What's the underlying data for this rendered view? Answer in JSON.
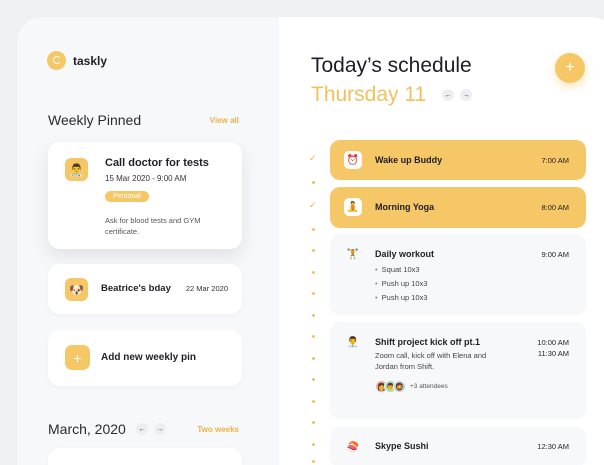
{
  "brand": {
    "name": "taskly"
  },
  "pinned": {
    "heading": "Weekly Pinned",
    "view_all": "View all",
    "cards": [
      {
        "title": "Call doctor for tests",
        "datetime": "15 Mar 2020 - 9:00 AM",
        "tag": "Personal",
        "description": "Ask for blood tests and GYM certificate.",
        "avatar": "doctor"
      },
      {
        "title": "Beatrice's bday",
        "date": "22 Mar 2020",
        "avatar": "dog"
      }
    ],
    "add_label": "Add new weekly pin"
  },
  "calendar": {
    "month": "March, 2020",
    "range": "Two weeks"
  },
  "schedule": {
    "title": "Today’s schedule",
    "day": "Thursday 11",
    "events": [
      {
        "title": "Wake up Buddy",
        "time": "7:00 AM",
        "icon": "alarm-clock-icon",
        "highlighted": true,
        "done": true
      },
      {
        "title": "Morning Yoga",
        "time": "8:00 AM",
        "icon": "yoga-icon",
        "highlighted": true,
        "done": true
      },
      {
        "title": "Daily workout",
        "time": "9:00 AM",
        "icon": "workout-icon",
        "items": [
          "Squat 10x3",
          "Push up 10x3",
          "Push up 10x3"
        ]
      },
      {
        "title": "Shift project kick off pt.1",
        "time_start": "10:00 AM",
        "time_end": "11:30 AM",
        "icon": "meeting-icon",
        "description": "Zoom call, kick off with Elena and Jordan from Shift.",
        "attendees_more": "+3 attendees"
      },
      {
        "title": "Skype Sushi",
        "time": "12:30 AM",
        "icon": "sushi-icon"
      }
    ]
  },
  "colors": {
    "accent": "#f6c766",
    "accent_text": "#f1c15f",
    "panel": "#f7f8fa"
  }
}
